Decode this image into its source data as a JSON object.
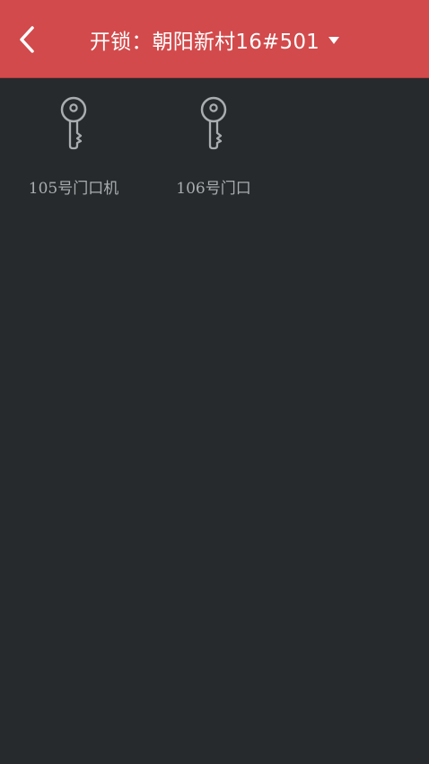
{
  "header": {
    "title": "开锁：朝阳新村16#501",
    "back_icon": "chevron-left-icon",
    "dropdown_icon": "caret-down-icon"
  },
  "doors": [
    {
      "label": "105号门口机",
      "icon": "key-icon"
    },
    {
      "label": "106号门口",
      "icon": "key-icon"
    }
  ],
  "colors": {
    "header_bg": "#d24a4b",
    "page_bg": "#272a2c",
    "icon": "#a9adb0",
    "label": "#a9adb0"
  }
}
